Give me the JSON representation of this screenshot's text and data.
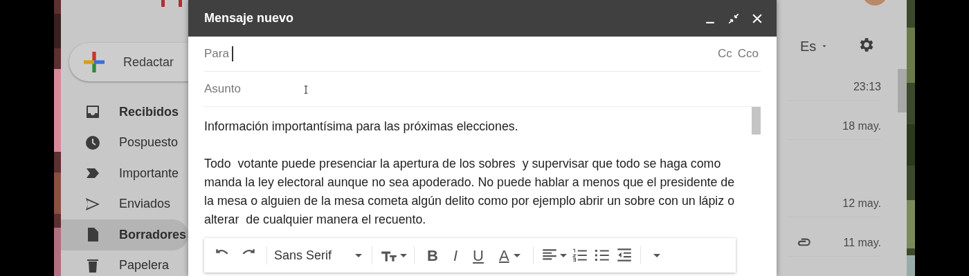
{
  "sidebar": {
    "compose_button": "Redactar",
    "items": [
      {
        "label": "Recibidos",
        "kind": "inbox",
        "bold": true,
        "selected": false
      },
      {
        "label": "Pospuesto",
        "kind": "clock",
        "bold": false,
        "selected": false
      },
      {
        "label": "Importante",
        "kind": "label",
        "bold": false,
        "selected": false
      },
      {
        "label": "Enviados",
        "kind": "send",
        "bold": false,
        "selected": false
      },
      {
        "label": "Borradores",
        "kind": "draft",
        "bold": true,
        "selected": true
      },
      {
        "label": "Papelera",
        "kind": "trash",
        "bold": false,
        "selected": false
      }
    ]
  },
  "header": {
    "language": "Es"
  },
  "mail_list": [
    {
      "date": "23:13",
      "attachment": false
    },
    {
      "date": "18 may.",
      "attachment": false
    },
    {
      "date": "12 may.",
      "attachment": false
    },
    {
      "date": "11 may.",
      "attachment": true
    }
  ],
  "compose": {
    "title": "Mensaje nuevo",
    "to_label": "Para",
    "cc": "Cc",
    "bcc": "Cco",
    "subject_placeholder": "Asunto",
    "body": [
      "Información importantísima para las próximas elecciones.",
      "Todo  votante puede presenciar la apertura de los sobres  y supervisar que todo se haga como manda la ley electoral aunque no sea apoderado. No puede hablar a menos que el presidente de la mesa o alguien de la mesa cometa algún delito como por ejemplo abrir un sobre con un lápiz o alterar  de cualquier manera el recuento."
    ],
    "toolbar": {
      "font": "Sans Serif",
      "format_buttons": [
        {
          "label": "B",
          "kind": "bold"
        },
        {
          "label": "I",
          "kind": "italic"
        },
        {
          "label": "U",
          "kind": "underline"
        },
        {
          "label": "A",
          "kind": "color"
        }
      ]
    }
  }
}
